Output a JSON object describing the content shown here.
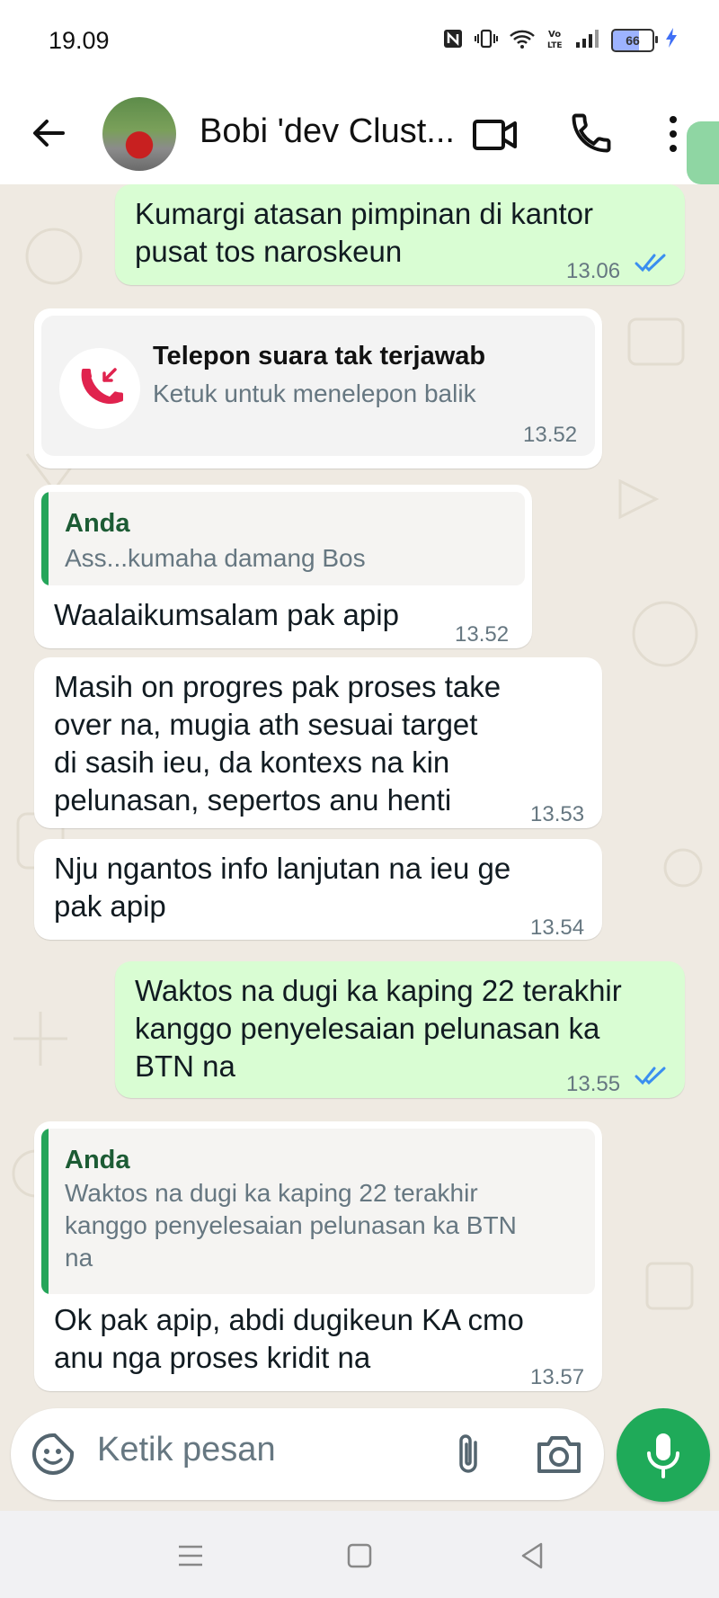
{
  "status_bar": {
    "time": "19.09",
    "battery": "66"
  },
  "header": {
    "contact_name": "Bobi 'dev Clust..."
  },
  "messages": [
    {
      "type": "outgoing",
      "text_lines": [
        "Kumargi atasan pimpinan di kantor",
        "pusat tos naroskeun"
      ],
      "time": "13.06",
      "read": true
    },
    {
      "type": "missed_call",
      "title": "Telepon suara tak terjawab",
      "subtitle": "Ketuk untuk menelepon balik",
      "time": "13.52"
    },
    {
      "type": "incoming_reply",
      "quote_author": "Anda",
      "quote_lines": [
        "Ass...kumaha damang Bos"
      ],
      "text_lines": [
        "Waalaikumsalam pak apip"
      ],
      "time": "13.52"
    },
    {
      "type": "incoming",
      "text_lines": [
        "Masih on progres pak proses take",
        "over na, mugia ath sesuai target",
        "di sasih ieu, da kontexs na kin",
        "pelunasan, sepertos anu henti"
      ],
      "time": "13.53"
    },
    {
      "type": "incoming",
      "text_lines": [
        "Nju ngantos info lanjutan na ieu ge",
        "pak apip"
      ],
      "time": "13.54"
    },
    {
      "type": "outgoing",
      "text_lines": [
        "Waktos na dugi ka kaping 22 terakhir",
        "kanggo penyelesaian pelunasan ka",
        "BTN na"
      ],
      "time": "13.55",
      "read": true
    },
    {
      "type": "incoming_reply",
      "quote_author": "Anda",
      "quote_lines": [
        "Waktos na dugi ka kaping 22 terakhir",
        "kanggo penyelesaian pelunasan ka BTN",
        "na"
      ],
      "text_lines": [
        "Ok pak apip, abdi dugikeun KA cmo",
        "anu nga proses kridit na"
      ],
      "time": "13.57"
    }
  ],
  "composer": {
    "placeholder": "Ketik pesan"
  },
  "colors": {
    "outgoing_bubble": "#d9fdd3",
    "incoming_bubble": "#ffffff",
    "accent_green": "#1faa59",
    "read_ticks": "#3a8ef0",
    "missed_call": "#e0234e"
  }
}
